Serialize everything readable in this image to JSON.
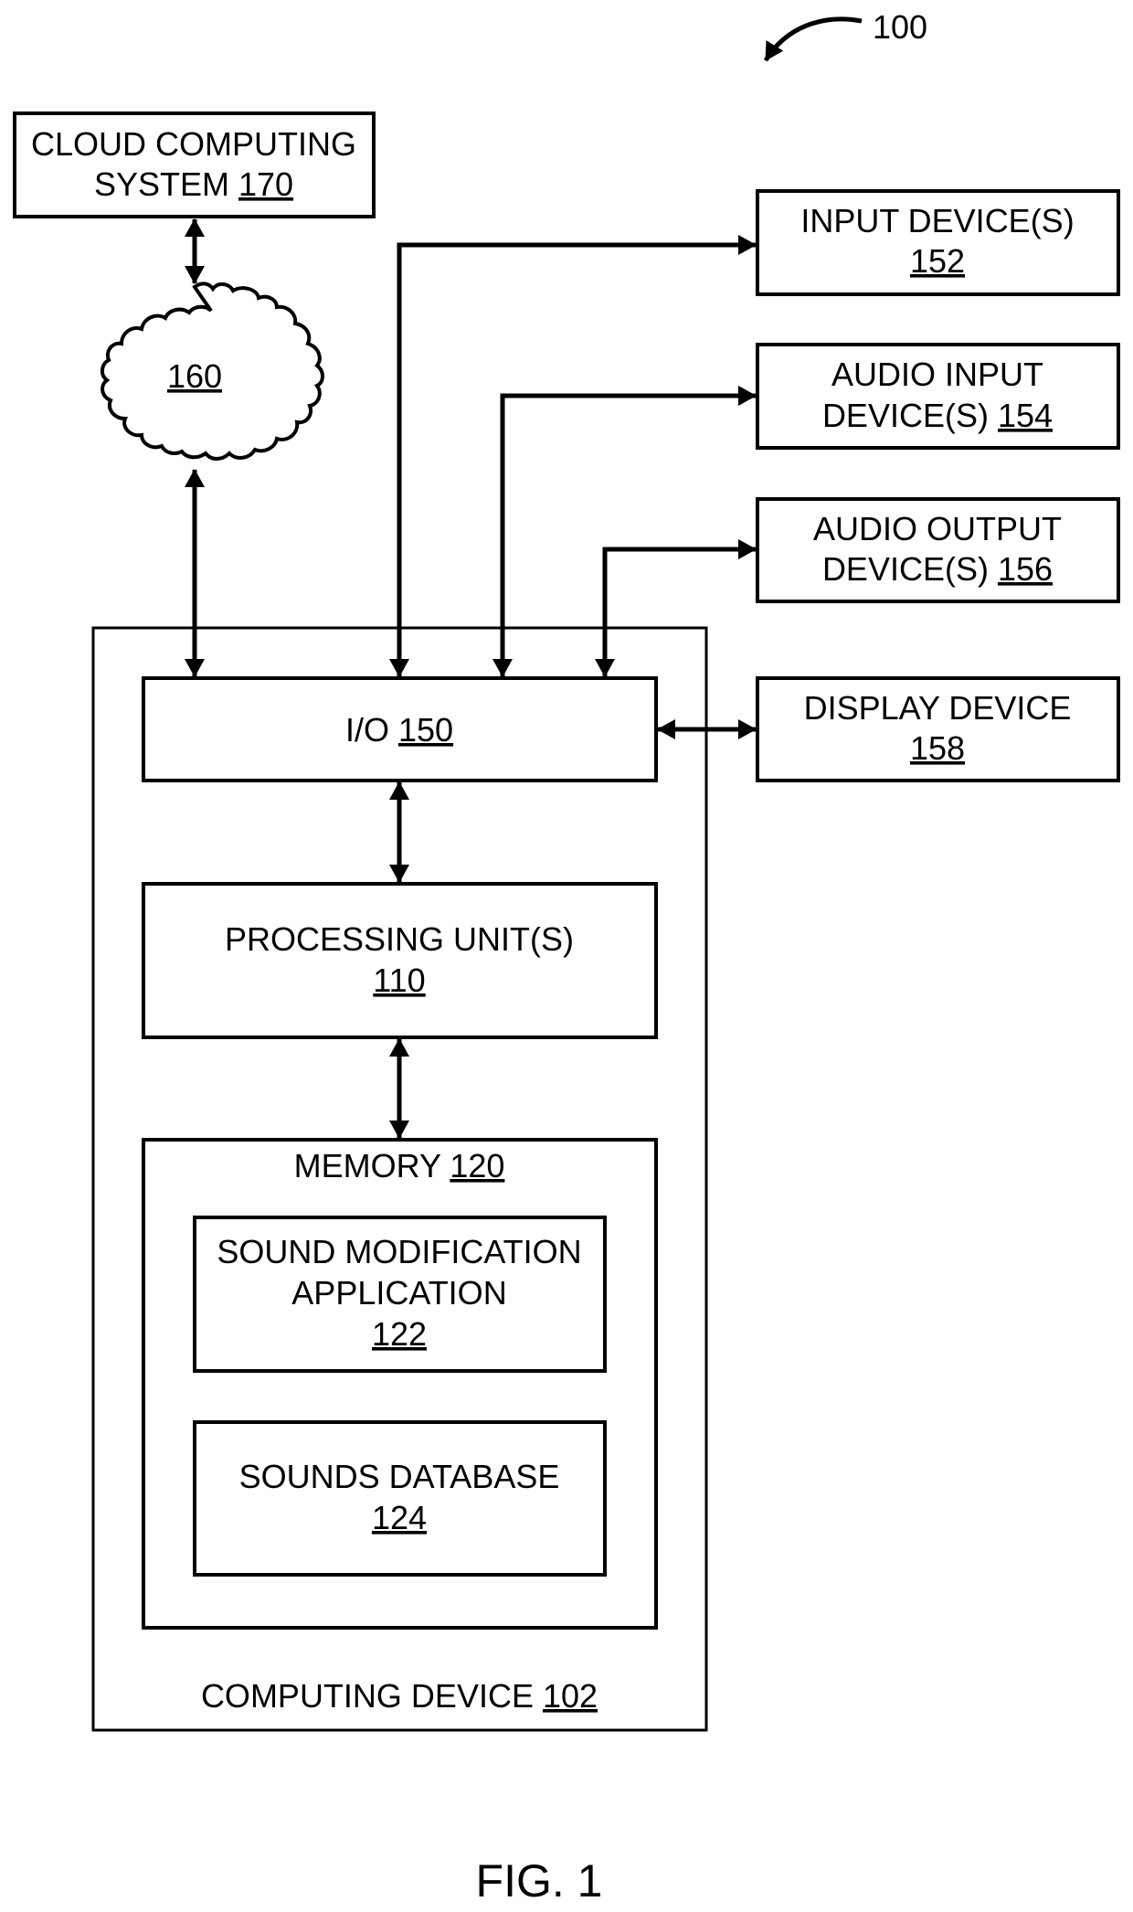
{
  "figure": {
    "reference_number": "100",
    "caption": "FIG. 1"
  },
  "cloud_computing_system": {
    "line1": "CLOUD COMPUTING",
    "line2_text": "SYSTEM ",
    "ref": "170"
  },
  "network": {
    "ref": "160"
  },
  "input_devices": {
    "line1": "INPUT DEVICE(S)",
    "ref": "152"
  },
  "audio_input_devices": {
    "line1": "AUDIO INPUT",
    "line2_text": "DEVICE(S) ",
    "ref": "154"
  },
  "audio_output_devices": {
    "line1": "AUDIO OUTPUT",
    "line2_text": "DEVICE(S) ",
    "ref": "156"
  },
  "display_device": {
    "line1": "DISPLAY DEVICE",
    "ref": "158"
  },
  "io": {
    "text": "I/O ",
    "ref": "150"
  },
  "processing_units": {
    "line1": "PROCESSING UNIT(S)",
    "ref": "110"
  },
  "memory": {
    "text": "MEMORY ",
    "ref": "120"
  },
  "sound_modification_application": {
    "line1": "SOUND MODIFICATION",
    "line2": "APPLICATION",
    "ref": "122"
  },
  "sounds_database": {
    "line1": "SOUNDS DATABASE",
    "ref": "124"
  },
  "computing_device": {
    "text": "COMPUTING DEVICE ",
    "ref": "102"
  }
}
